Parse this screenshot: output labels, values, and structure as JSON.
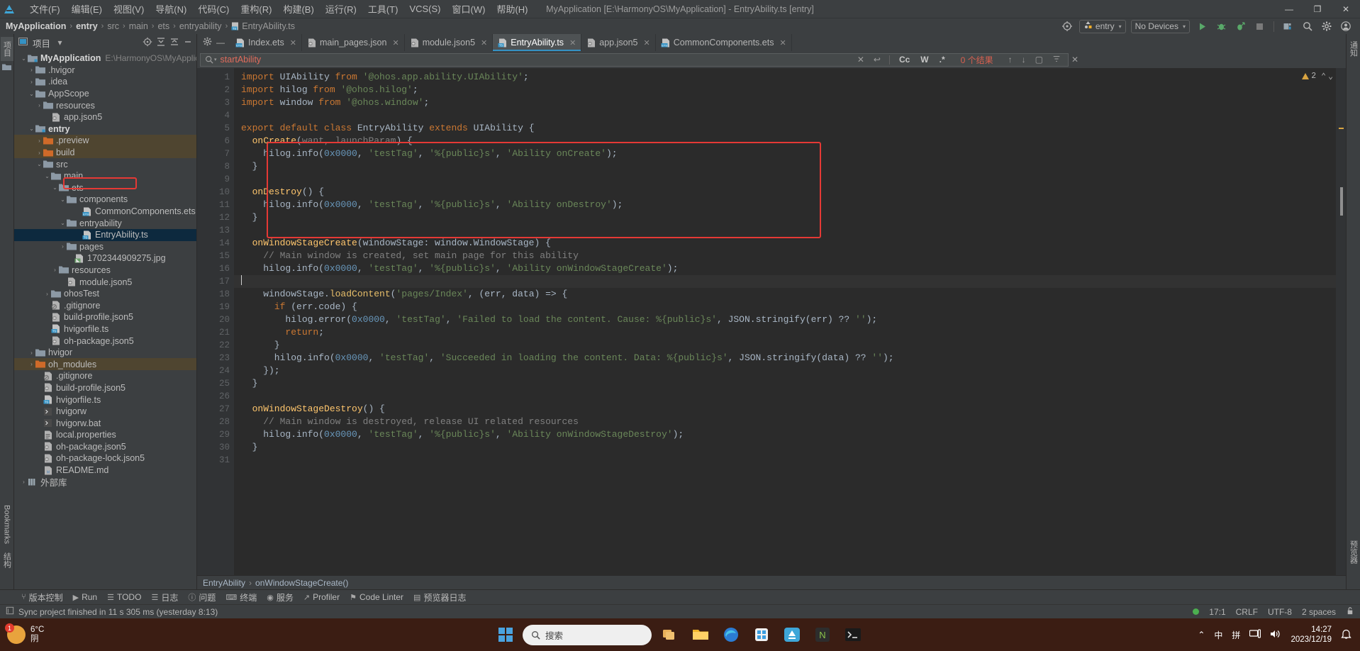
{
  "window": {
    "title": "MyApplication [E:\\HarmonyOS\\MyApplication] - EntryAbility.ts [entry]",
    "minimize": "—",
    "maximize": "❐",
    "close": "✕"
  },
  "menu": {
    "items": [
      "文件(F)",
      "编辑(E)",
      "视图(V)",
      "导航(N)",
      "代码(C)",
      "重构(R)",
      "构建(B)",
      "运行(R)",
      "工具(T)",
      "VCS(S)",
      "窗口(W)",
      "帮助(H)"
    ]
  },
  "breadcrumb": {
    "items": [
      "MyApplication",
      "entry",
      "src",
      "main",
      "ets",
      "entryability",
      "EntryAbility.ts"
    ],
    "separator": "›"
  },
  "toolbar": {
    "target_icon": "target-icon",
    "module_selector": "entry",
    "device_selector": "No Devices",
    "caret": "▾",
    "run_label": "▶",
    "debug_label": "debug-icon",
    "profile_label": "profile-icon",
    "stop_label": "■",
    "device_manager": "device-manager-icon",
    "search_everywhere": "⌕",
    "settings": "⚙",
    "account": "ⓘ"
  },
  "sidebar_left": {
    "tabs": [
      "项目",
      "结构"
    ],
    "bookmarks": "Bookmarks",
    "notifications": "通知"
  },
  "project_panel": {
    "title": "项目",
    "caret": "▾",
    "actions": [
      "locate-icon",
      "expand-all-icon",
      "collapse-all-icon",
      "hide-icon"
    ],
    "tree": [
      {
        "label": "MyApplication",
        "path": "E:\\HarmonyOS\\MyApplicatio",
        "depth": 0,
        "arrow": "⌄",
        "icon": "module-folder",
        "bold": true
      },
      {
        "label": ".hvigor",
        "depth": 1,
        "arrow": "›",
        "icon": "folder"
      },
      {
        "label": ".idea",
        "depth": 1,
        "arrow": "›",
        "icon": "folder"
      },
      {
        "label": "AppScope",
        "depth": 1,
        "arrow": "⌄",
        "icon": "folder"
      },
      {
        "label": "resources",
        "depth": 2,
        "arrow": "›",
        "icon": "folder"
      },
      {
        "label": "app.json5",
        "depth": 3,
        "arrow": "",
        "icon": "json"
      },
      {
        "label": "entry",
        "depth": 1,
        "arrow": "⌄",
        "icon": "module-folder",
        "bold": true
      },
      {
        "label": ".preview",
        "depth": 2,
        "arrow": "›",
        "icon": "folder-orange",
        "highlight": "yellow"
      },
      {
        "label": "build",
        "depth": 2,
        "arrow": "›",
        "icon": "folder-orange",
        "highlight": "yellow"
      },
      {
        "label": "src",
        "depth": 2,
        "arrow": "⌄",
        "icon": "folder"
      },
      {
        "label": "main",
        "depth": 3,
        "arrow": "⌄",
        "icon": "folder"
      },
      {
        "label": "ets",
        "depth": 4,
        "arrow": "⌄",
        "icon": "folder"
      },
      {
        "label": "components",
        "depth": 5,
        "arrow": "⌄",
        "icon": "folder"
      },
      {
        "label": "CommonComponents.ets",
        "depth": 7,
        "arrow": "",
        "icon": "ets"
      },
      {
        "label": "entryability",
        "depth": 5,
        "arrow": "⌄",
        "icon": "folder"
      },
      {
        "label": "EntryAbility.ts",
        "depth": 7,
        "arrow": "",
        "icon": "ts",
        "selected": true,
        "boxed": true
      },
      {
        "label": "pages",
        "depth": 5,
        "arrow": "›",
        "icon": "folder"
      },
      {
        "label": "1702344909275.jpg",
        "depth": 6,
        "arrow": "",
        "icon": "image"
      },
      {
        "label": "resources",
        "depth": 4,
        "arrow": "›",
        "icon": "folder"
      },
      {
        "label": "module.json5",
        "depth": 5,
        "arrow": "",
        "icon": "json"
      },
      {
        "label": "ohosTest",
        "depth": 3,
        "arrow": "›",
        "icon": "folder"
      },
      {
        "label": ".gitignore",
        "depth": 3,
        "arrow": "",
        "icon": "gitignore"
      },
      {
        "label": "build-profile.json5",
        "depth": 3,
        "arrow": "",
        "icon": "json"
      },
      {
        "label": "hvigorfile.ts",
        "depth": 3,
        "arrow": "",
        "icon": "ts"
      },
      {
        "label": "oh-package.json5",
        "depth": 3,
        "arrow": "",
        "icon": "json"
      },
      {
        "label": "hvigor",
        "depth": 1,
        "arrow": "›",
        "icon": "folder"
      },
      {
        "label": "oh_modules",
        "depth": 1,
        "arrow": "›",
        "icon": "folder-orange",
        "highlight": "yellow"
      },
      {
        "label": ".gitignore",
        "depth": 2,
        "arrow": "",
        "icon": "gitignore"
      },
      {
        "label": "build-profile.json5",
        "depth": 2,
        "arrow": "",
        "icon": "json"
      },
      {
        "label": "hvigorfile.ts",
        "depth": 2,
        "arrow": "",
        "icon": "ts"
      },
      {
        "label": "hvigorw",
        "depth": 2,
        "arrow": "",
        "icon": "script"
      },
      {
        "label": "hvigorw.bat",
        "depth": 2,
        "arrow": "",
        "icon": "script"
      },
      {
        "label": "local.properties",
        "depth": 2,
        "arrow": "",
        "icon": "props"
      },
      {
        "label": "oh-package.json5",
        "depth": 2,
        "arrow": "",
        "icon": "json"
      },
      {
        "label": "oh-package-lock.json5",
        "depth": 2,
        "arrow": "",
        "icon": "json"
      },
      {
        "label": "README.md",
        "depth": 2,
        "arrow": "",
        "icon": "md"
      },
      {
        "label": "外部库",
        "depth": 0,
        "arrow": "›",
        "icon": "library"
      }
    ]
  },
  "editor_tabs": {
    "pin_icon": "settings-gear-icon",
    "minimize_icon": "—",
    "items": [
      {
        "label": "Index.ets",
        "icon": "ets",
        "active": false
      },
      {
        "label": "main_pages.json",
        "icon": "json",
        "active": false
      },
      {
        "label": "module.json5",
        "icon": "json",
        "active": false
      },
      {
        "label": "EntryAbility.ts",
        "icon": "ts",
        "active": true
      },
      {
        "label": "app.json5",
        "icon": "json",
        "active": false
      },
      {
        "label": "CommonComponents.ets",
        "icon": "ets",
        "active": false
      }
    ],
    "close_glyph": "✕"
  },
  "find_bar": {
    "search_icon": "⌕",
    "caret": "▾",
    "value": "startAbility",
    "clear": "✕",
    "history": "↩",
    "match_case": "Cc",
    "words": "W",
    "regex": ".*",
    "result_count": "0 个结果",
    "prev": "↑",
    "next": "↓",
    "select_all": "▢",
    "filter": "∇",
    "close": "✕"
  },
  "code": {
    "first_line": 1,
    "warning_count": "2",
    "warning_up": "⌃",
    "warning_down": "⌄",
    "cursor_line": 17,
    "lines": [
      {
        "n": 1,
        "tokens": [
          {
            "t": "import ",
            "c": "kw"
          },
          {
            "t": "UIAbility ",
            "c": "white"
          },
          {
            "t": "from ",
            "c": "kw"
          },
          {
            "t": "'@ohos.app.ability.UIAbility'",
            "c": "str"
          },
          {
            "t": ";",
            "c": "white"
          }
        ],
        "fold": "start"
      },
      {
        "n": 2,
        "tokens": [
          {
            "t": "import ",
            "c": "kw"
          },
          {
            "t": "hilog ",
            "c": "white"
          },
          {
            "t": "from ",
            "c": "kw"
          },
          {
            "t": "'@ohos.hilog'",
            "c": "str"
          },
          {
            "t": ";",
            "c": "white"
          }
        ]
      },
      {
        "n": 3,
        "tokens": [
          {
            "t": "import ",
            "c": "kw"
          },
          {
            "t": "window ",
            "c": "white"
          },
          {
            "t": "from ",
            "c": "kw"
          },
          {
            "t": "'@ohos.window'",
            "c": "str"
          },
          {
            "t": ";",
            "c": "white"
          }
        ]
      },
      {
        "n": 4,
        "tokens": []
      },
      {
        "n": 5,
        "tokens": [
          {
            "t": "export default class ",
            "c": "kw"
          },
          {
            "t": "EntryAbility ",
            "c": "white"
          },
          {
            "t": "extends ",
            "c": "kw"
          },
          {
            "t": "UIAbility ",
            "c": "white"
          },
          {
            "t": "{",
            "c": "white"
          }
        ],
        "fold": "start"
      },
      {
        "n": 6,
        "tokens": [
          {
            "t": "  onCreate",
            "c": "fn"
          },
          {
            "t": "(",
            "c": "white"
          },
          {
            "t": "want, launchParam",
            "c": "cmt"
          },
          {
            "t": ") {",
            "c": "white"
          }
        ],
        "fold": "start"
      },
      {
        "n": 7,
        "tokens": [
          {
            "t": "    hilog.",
            "c": "white"
          },
          {
            "t": "info",
            "c": "white"
          },
          {
            "t": "(",
            "c": "white"
          },
          {
            "t": "0x0000",
            "c": "num"
          },
          {
            "t": ", ",
            "c": "white"
          },
          {
            "t": "'testTag'",
            "c": "str"
          },
          {
            "t": ", ",
            "c": "white"
          },
          {
            "t": "'%{public}s'",
            "c": "str"
          },
          {
            "t": ", ",
            "c": "white"
          },
          {
            "t": "'Ability onCreate'",
            "c": "str"
          },
          {
            "t": ");",
            "c": "white"
          }
        ]
      },
      {
        "n": 8,
        "tokens": [
          {
            "t": "  }",
            "c": "white"
          }
        ],
        "fold": "end"
      },
      {
        "n": 9,
        "tokens": []
      },
      {
        "n": 10,
        "tokens": [
          {
            "t": "  onDestroy",
            "c": "fn"
          },
          {
            "t": "() {",
            "c": "white"
          }
        ],
        "fold": "start"
      },
      {
        "n": 11,
        "tokens": [
          {
            "t": "    hilog.info(",
            "c": "white"
          },
          {
            "t": "0x0000",
            "c": "num"
          },
          {
            "t": ", ",
            "c": "white"
          },
          {
            "t": "'testTag'",
            "c": "str"
          },
          {
            "t": ", ",
            "c": "white"
          },
          {
            "t": "'%{public}s'",
            "c": "str"
          },
          {
            "t": ", ",
            "c": "white"
          },
          {
            "t": "'Ability onDestroy'",
            "c": "str"
          },
          {
            "t": ");",
            "c": "white"
          }
        ]
      },
      {
        "n": 12,
        "tokens": [
          {
            "t": "  }",
            "c": "white"
          }
        ],
        "fold": "end"
      },
      {
        "n": 13,
        "tokens": []
      },
      {
        "n": 14,
        "tokens": [
          {
            "t": "  onWindowStageCreate",
            "c": "fn"
          },
          {
            "t": "(windowStage: ",
            "c": "white"
          },
          {
            "t": "window",
            "c": "white"
          },
          {
            "t": ".WindowStage) {",
            "c": "white"
          }
        ],
        "fold": "start"
      },
      {
        "n": 15,
        "tokens": [
          {
            "t": "    // Main window is created, set main page for this ability",
            "c": "cmt"
          }
        ]
      },
      {
        "n": 16,
        "tokens": [
          {
            "t": "    hilog.info(",
            "c": "white"
          },
          {
            "t": "0x0000",
            "c": "num"
          },
          {
            "t": ", ",
            "c": "white"
          },
          {
            "t": "'testTag'",
            "c": "str"
          },
          {
            "t": ", ",
            "c": "white"
          },
          {
            "t": "'%{public}s'",
            "c": "str"
          },
          {
            "t": ", ",
            "c": "white"
          },
          {
            "t": "'Ability onWindowStageCreate'",
            "c": "str"
          },
          {
            "t": ");",
            "c": "white"
          }
        ],
        "bulb": true
      },
      {
        "n": 17,
        "tokens": [],
        "current": true
      },
      {
        "n": 18,
        "tokens": [
          {
            "t": "    windowStage.",
            "c": "white"
          },
          {
            "t": "loadContent",
            "c": "hi"
          },
          {
            "t": "(",
            "c": "white"
          },
          {
            "t": "'pages/Index'",
            "c": "str"
          },
          {
            "t": ", (err, data) => {",
            "c": "white"
          }
        ],
        "fold": "start"
      },
      {
        "n": 19,
        "tokens": [
          {
            "t": "      ",
            "c": "white"
          },
          {
            "t": "if ",
            "c": "kw"
          },
          {
            "t": "(err.code) {",
            "c": "white"
          }
        ],
        "fold": "start"
      },
      {
        "n": 20,
        "tokens": [
          {
            "t": "        hilog.",
            "c": "white"
          },
          {
            "t": "error",
            "c": "white"
          },
          {
            "t": "(",
            "c": "white"
          },
          {
            "t": "0x0000",
            "c": "num"
          },
          {
            "t": ", ",
            "c": "white"
          },
          {
            "t": "'testTag'",
            "c": "str"
          },
          {
            "t": ", ",
            "c": "white"
          },
          {
            "t": "'Failed to load the content. Cause: %{public}s'",
            "c": "str"
          },
          {
            "t": ", JSON.stringify(err) ?? ",
            "c": "white"
          },
          {
            "t": "''",
            "c": "str"
          },
          {
            "t": ");",
            "c": "white"
          }
        ]
      },
      {
        "n": 21,
        "tokens": [
          {
            "t": "        ",
            "c": "white"
          },
          {
            "t": "return",
            "c": "kw"
          },
          {
            "t": ";",
            "c": "white"
          }
        ]
      },
      {
        "n": 22,
        "tokens": [
          {
            "t": "      }",
            "c": "white"
          }
        ],
        "fold": "end"
      },
      {
        "n": 23,
        "tokens": [
          {
            "t": "      hilog.info(",
            "c": "white"
          },
          {
            "t": "0x0000",
            "c": "num"
          },
          {
            "t": ", ",
            "c": "white"
          },
          {
            "t": "'testTag'",
            "c": "str"
          },
          {
            "t": ", ",
            "c": "white"
          },
          {
            "t": "'Succeeded in loading the content. Data: %{public}s'",
            "c": "str"
          },
          {
            "t": ", JSON.stringify(data) ?? ",
            "c": "white"
          },
          {
            "t": "''",
            "c": "str"
          },
          {
            "t": ");",
            "c": "white"
          }
        ]
      },
      {
        "n": 24,
        "tokens": [
          {
            "t": "    });",
            "c": "white"
          }
        ],
        "fold": "end"
      },
      {
        "n": 25,
        "tokens": [
          {
            "t": "  }",
            "c": "white"
          }
        ],
        "fold": "end"
      },
      {
        "n": 26,
        "tokens": []
      },
      {
        "n": 27,
        "tokens": [
          {
            "t": "  onWindowStageDestroy",
            "c": "fn"
          },
          {
            "t": "() {",
            "c": "white"
          }
        ],
        "fold": "start"
      },
      {
        "n": 28,
        "tokens": [
          {
            "t": "    // Main window is destroyed, release UI related resources",
            "c": "cmt"
          }
        ]
      },
      {
        "n": 29,
        "tokens": [
          {
            "t": "    hilog.info(",
            "c": "white"
          },
          {
            "t": "0x0000",
            "c": "num"
          },
          {
            "t": ", ",
            "c": "white"
          },
          {
            "t": "'testTag'",
            "c": "str"
          },
          {
            "t": ", ",
            "c": "white"
          },
          {
            "t": "'%{public}s'",
            "c": "str"
          },
          {
            "t": ", ",
            "c": "white"
          },
          {
            "t": "'Ability onWindowStageDestroy'",
            "c": "str"
          },
          {
            "t": ");",
            "c": "white"
          }
        ]
      },
      {
        "n": 30,
        "tokens": [
          {
            "t": "  }",
            "c": "white"
          }
        ],
        "fold": "end"
      },
      {
        "n": 31,
        "tokens": []
      }
    ]
  },
  "editor_breadcrumb": {
    "items": [
      "EntryAbility",
      "onWindowStageCreate()"
    ],
    "separator": "›"
  },
  "bottom_tools": [
    {
      "label": "版本控制",
      "icon": "branch-icon"
    },
    {
      "label": "Run",
      "icon": "play-icon"
    },
    {
      "label": "TODO",
      "icon": "list-icon"
    },
    {
      "label": "日志",
      "icon": "log-icon"
    },
    {
      "label": "问题",
      "icon": "warning-icon"
    },
    {
      "label": "终端",
      "icon": "terminal-icon"
    },
    {
      "label": "服务",
      "icon": "services-icon"
    },
    {
      "label": "Profiler",
      "icon": "profiler-icon"
    },
    {
      "label": "Code Linter",
      "icon": "linter-icon"
    },
    {
      "label": "预览器日志",
      "icon": "preview-log-icon"
    }
  ],
  "status_bar": {
    "message": "Sync project finished in 11 s 305 ms (yesterday 8:13)",
    "message_icon": "log-icon",
    "position": "17:1",
    "line_separator": "CRLF",
    "encoding": "UTF-8",
    "indent": "2 spaces",
    "lock_icon": "lock-icon"
  },
  "taskbar": {
    "weather_temp": "6°C",
    "weather_desc": "阴",
    "weather_badge": "1",
    "search_placeholder": "搜索",
    "search_icon": "⌕",
    "apps": [
      "task-view-icon",
      "file-explorer-icon",
      "edge-icon",
      "store-icon",
      "deveco-icon",
      "nodejs-icon",
      "terminal-icon"
    ],
    "tray": {
      "chevron": "⌃",
      "ime_mode": "中",
      "ime_pinyin": "拼",
      "network": "network-icon",
      "volume": "volume-icon",
      "time": "14:27",
      "date": "2023/12/19",
      "notification": "bell-icon"
    }
  }
}
